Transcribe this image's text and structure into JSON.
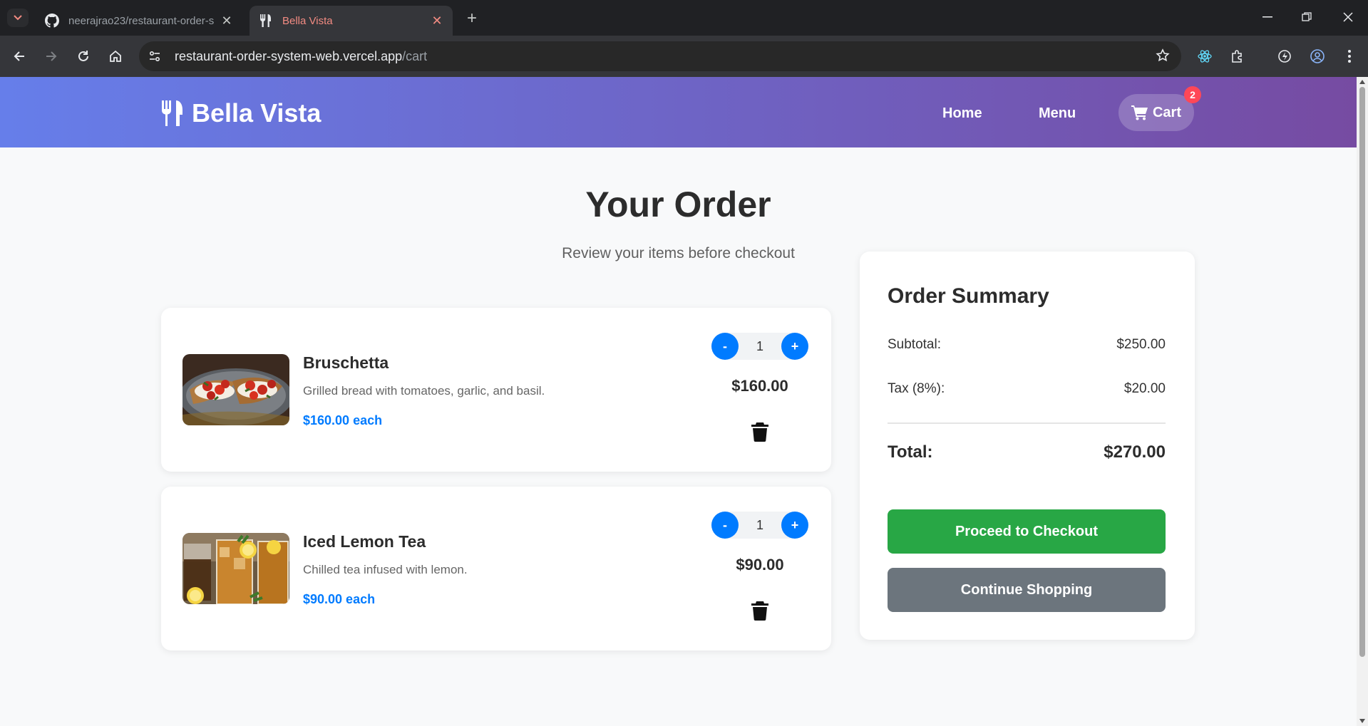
{
  "browser": {
    "tabs": [
      {
        "title": "neerajrao23/restaurant-order-s",
        "active": false
      },
      {
        "title": "Bella Vista",
        "active": true
      }
    ],
    "url_host": "restaurant-order-system-web.vercel.app",
    "url_path": "/cart"
  },
  "header": {
    "brand": "Bella Vista",
    "nav": {
      "home": "Home",
      "menu": "Menu",
      "cart": "Cart"
    },
    "cart_count": "2"
  },
  "page": {
    "title": "Your Order",
    "subtitle": "Review your items before checkout"
  },
  "items": [
    {
      "name": "Bruschetta",
      "description": "Grilled bread with tomatoes, garlic, and basil.",
      "unit_price": "$160.00 each",
      "quantity": "1",
      "total": "$160.00",
      "minus": "-",
      "plus": "+"
    },
    {
      "name": "Iced Lemon Tea",
      "description": "Chilled tea infused with lemon.",
      "unit_price": "$90.00 each",
      "quantity": "1",
      "total": "$90.00",
      "minus": "-",
      "plus": "+"
    }
  ],
  "summary": {
    "title": "Order Summary",
    "subtotal_label": "Subtotal:",
    "subtotal_value": "$250.00",
    "tax_label": "Tax (8%):",
    "tax_value": "$20.00",
    "total_label": "Total:",
    "total_value": "$270.00",
    "checkout_label": "Proceed to Checkout",
    "continue_label": "Continue Shopping"
  },
  "colors": {
    "header_gradient_start": "#667eea",
    "header_gradient_end": "#764ba2",
    "accent_blue": "#007bff",
    "checkout_green": "#28a745",
    "continue_gray": "#6c757d",
    "badge_red": "#ff4757"
  }
}
